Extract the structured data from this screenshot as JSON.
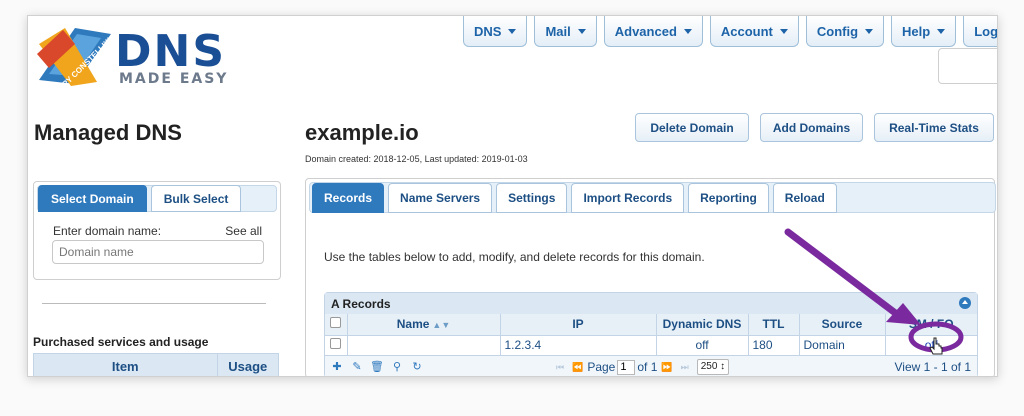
{
  "topnav": [
    {
      "label": "DNS",
      "name": "menu-dns"
    },
    {
      "label": "Mail",
      "name": "menu-mail"
    },
    {
      "label": "Advanced",
      "name": "menu-advanced"
    },
    {
      "label": "Account",
      "name": "menu-account"
    },
    {
      "label": "Config",
      "name": "menu-config"
    },
    {
      "label": "Help",
      "name": "menu-help"
    },
    {
      "label": "Logou",
      "name": "menu-logout"
    }
  ],
  "logo": {
    "brand": "DNS",
    "sub": "MADE EASY",
    "ribbon": "TRY CONSTELLIX!"
  },
  "left": {
    "title": "Managed DNS",
    "tabs": [
      "Select Domain",
      "Bulk Select"
    ],
    "enter_label": "Enter domain name:",
    "see_all": "See all",
    "domain_placeholder": "Domain name",
    "purchased_title": "Purchased services and usage",
    "usage_cols": [
      "Item",
      "Usage"
    ]
  },
  "domain": {
    "name": "example.io",
    "meta": "Domain created: 2018-12-05, Last updated: 2019-01-03",
    "actions": [
      "Delete Domain",
      "Add Domains",
      "Real-Time Stats"
    ],
    "tabs": [
      "Records",
      "Name Servers",
      "Settings",
      "Import Records",
      "Reporting",
      "Reload"
    ],
    "intro": "Use the tables below to add, modify, and delete records for this domain."
  },
  "a_records": {
    "caption": "A Records",
    "columns": [
      "Name",
      "IP",
      "Dynamic DNS",
      "TTL",
      "Source",
      "SM / FO"
    ],
    "rows": [
      {
        "name": "",
        "ip": "1.2.3.4",
        "dynamic_dns": "off",
        "ttl": "180",
        "source": "Domain",
        "sm_fo": "off"
      }
    ],
    "pager": {
      "page_label": "Page",
      "page": "1",
      "of_label": "of 1",
      "page_size": "250 ↕",
      "view": "View 1 - 1 of 1"
    }
  },
  "colors": {
    "accent": "#2f79bd",
    "link": "#1d63a8",
    "annotation": "#7a2a9e"
  }
}
